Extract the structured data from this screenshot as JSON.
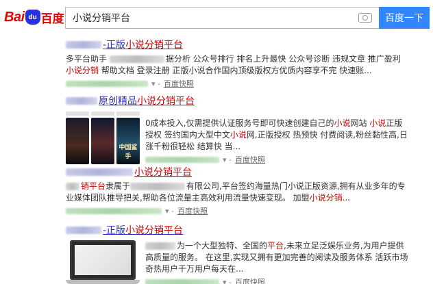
{
  "header": {
    "logo": {
      "latin": "Bai",
      "paw": "du",
      "chinese": "百度"
    },
    "search_value": "小说分销平台",
    "camera_icon": "camera-icon",
    "search_button": "百度一下"
  },
  "results": [
    {
      "title_pre": "-正版",
      "title_hl": "小说分销平台",
      "snippet_parts": [
        {
          "t": "多平台助手 ",
          "hl": false
        },
        {
          "t": "据分析 公众号排行 排名上升最快 公众号诊断 违规文章 推广盈利 ",
          "hl": false
        },
        {
          "t": "小说分销",
          "hl": true
        },
        {
          "t": " 帮助文档 登录注册 正版小说合作国内顶级版权方优质内容享不完 快速账...",
          "hl": false
        }
      ],
      "snapshot": "百度快照"
    },
    {
      "title_pre": "原创精品",
      "title_hl": "小说分销平台",
      "covers": [
        "",
        "",
        "中国鲨手"
      ],
      "snippet_parts": [
        {
          "t": "0成本投入,仅需提供认证服务号即可快速创建自己的",
          "hl": false
        },
        {
          "t": "小说",
          "hl": true
        },
        {
          "t": "网站 ",
          "hl": false
        },
        {
          "t": "小说",
          "hl": true
        },
        {
          "t": "正版授权 签约国内大型中文",
          "hl": false
        },
        {
          "t": "小说",
          "hl": true
        },
        {
          "t": "网,正版授权 热预快 付费阅读,粉丝黏性高,日涨千粉很轻松 结算快 当...",
          "hl": false
        }
      ],
      "snapshot": "百度快照"
    },
    {
      "title_pre": "",
      "title_hl": "小说分销平台",
      "snippet_parts": [
        {
          "t": "销平台",
          "hl": true
        },
        {
          "t": "隶属于",
          "hl": false
        },
        {
          "t": "有限公司,平台签约海量热门小说正版资源,拥有从业多年的专业媒体团队推导把关,帮助各位流量主高效利用流量快速变现。 加盟",
          "hl": false
        },
        {
          "t": "小说分销",
          "hl": true
        },
        {
          "t": "...",
          "hl": false
        }
      ],
      "snapshot": "百度快照"
    },
    {
      "title_pre": "-正版",
      "title_hl": "小说分销平台",
      "snippet_parts": [
        {
          "t": "为一个大型独特、全国的",
          "hl": false
        },
        {
          "t": "平台",
          "hl": true
        },
        {
          "t": ",未来立足泛娱乐业务,为用户提供高质量的服务。 在这里,实现又拥有更加完善的阅读及服务体系 活跃市场 奇热用户千万用户每天在...",
          "hl": false
        }
      ],
      "snapshot": "百度快照"
    }
  ]
}
